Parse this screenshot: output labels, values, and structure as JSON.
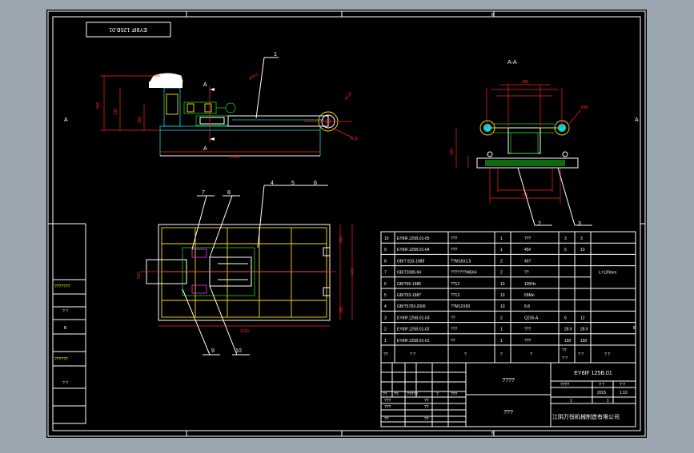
{
  "drawing": {
    "title_block_code": "EY8IF 125B.01",
    "title_block_code_top": "EY8IF 125B.01",
    "section_label": "A-A",
    "section_marker": "A",
    "border_zones": {
      "top": "B",
      "left": "A",
      "right": "A",
      "right_lower": "B",
      "bottom": "B"
    },
    "callouts": [
      "1",
      "2",
      "3",
      "4",
      "5",
      "6",
      "7",
      "8",
      "9",
      "10"
    ],
    "note": "L=120mm",
    "drawing_name": "????",
    "scale_text": "???",
    "company": "江阴万恒机械制造有限公司",
    "year": "2015",
    "sheet": "1/1"
  },
  "left_panel": {
    "rows": [
      "???????",
      "?  ?",
      "B",
      "??????",
      "?  ?"
    ]
  },
  "bom": [
    {
      "no": "10",
      "code": "EY8IF.125B.01-05",
      "name": "???",
      "qty": "1",
      "mat": "???",
      "w1": "3",
      "w2": "3",
      "note": ""
    },
    {
      "no": "9",
      "code": "EY8IF.125B.01-04",
      "name": "???",
      "qty": "1",
      "mat": "45#",
      "w1": "5",
      "w2": "10",
      "note": ""
    },
    {
      "no": "8",
      "code": "GB/T 810-1988",
      "name": "??M16X1.5",
      "qty": "2",
      "mat": "45?",
      "w1": "",
      "w2": "",
      "note": ""
    },
    {
      "no": "7",
      "code": "GB/T2089-94",
      "name": "???????M6X4",
      "qty": "2",
      "mat": "??",
      "w1": "",
      "w2": "",
      "note": "L=120mm"
    },
    {
      "no": "6",
      "code": "GB/T95-1985",
      "name": "??12",
      "qty": "10",
      "mat": "100Hv",
      "w1": "",
      "w2": "",
      "note": ""
    },
    {
      "no": "5",
      "code": "GB/T93-1987",
      "name": "??12",
      "qty": "10",
      "mat": "65Mn",
      "w1": "",
      "w2": "",
      "note": ""
    },
    {
      "no": "4",
      "code": "GB/T5783-2000",
      "name": "??M12X50",
      "qty": "10",
      "mat": "8.8",
      "w1": "",
      "w2": "",
      "note": ""
    },
    {
      "no": "3",
      "code": "EY8IF.125B.01-03",
      "name": "??",
      "qty": "2",
      "mat": "Q235-A",
      "w1": "6",
      "w2": "12",
      "note": ""
    },
    {
      "no": "2",
      "code": "EY8IF.125B.01-02",
      "name": "???",
      "qty": "1",
      "mat": "???",
      "w1": "28.5",
      "w2": "28.5",
      "note": ""
    },
    {
      "no": "1",
      "code": "EY8IF.125B.01-01",
      "name": "??",
      "qty": "1",
      "mat": "???",
      "w1": "150",
      "w2": "150",
      "note": ""
    }
  ],
  "bom_header": [
    "??",
    "?  ?",
    "?",
    "?",
    "?",
    "??",
    "?  ?",
    "? ?",
    "?  ?"
  ],
  "title_rows": {
    "r1": [
      "??",
      "??",
      "?????",
      "?",
      "???"
    ],
    "r2": [
      "???",
      "??"
    ],
    "r3": [
      "???",
      "??"
    ],
    "r4": [
      "??",
      "??"
    ],
    "meta": [
      "????",
      "? ?",
      "? ?"
    ],
    "meta_vals": [
      "2015",
      "1:10"
    ],
    "meta_vals2": [
      "1",
      "1"
    ]
  },
  "dims": {
    "d1": "1380",
    "d2": "1100",
    "d3": "560",
    "d4": "315",
    "d5": "600",
    "d6": "530",
    "d7": "1100",
    "d8": "280",
    "d9": "350",
    "d10": "470",
    "d11": "280",
    "d12": "320",
    "d13": "250",
    "d14": "260"
  }
}
